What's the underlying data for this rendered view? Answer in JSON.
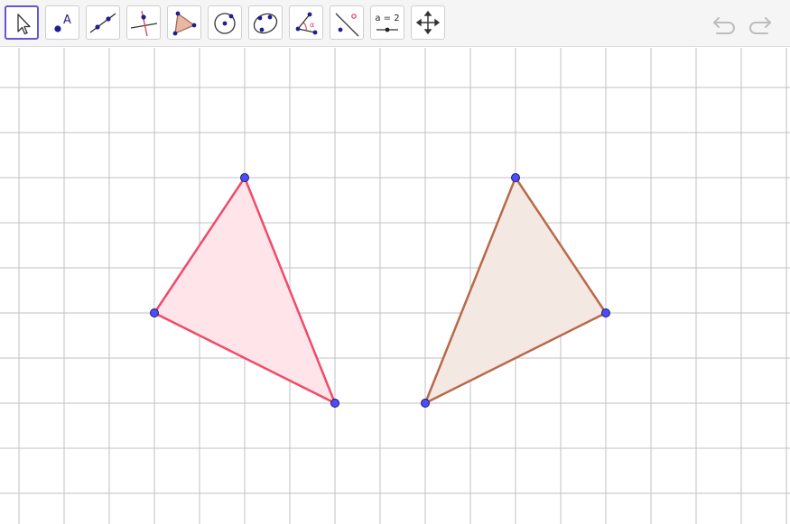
{
  "toolbar": {
    "tools": [
      {
        "name": "move-tool",
        "icon": "pointer-arrow-icon",
        "selected": true
      },
      {
        "name": "point-tool",
        "icon": "point-icon",
        "label": "A"
      },
      {
        "name": "line-tool",
        "icon": "line-through-two-points-icon"
      },
      {
        "name": "perpendicular-line-tool",
        "icon": "perpendicular-line-icon"
      },
      {
        "name": "polygon-tool",
        "icon": "polygon-icon"
      },
      {
        "name": "circle-tool",
        "icon": "circle-center-point-icon"
      },
      {
        "name": "conic-tool",
        "icon": "ellipse-icon"
      },
      {
        "name": "angle-tool",
        "icon": "angle-icon",
        "label": "α"
      },
      {
        "name": "reflect-tool",
        "icon": "reflect-about-line-icon"
      },
      {
        "name": "slider-tool",
        "icon": "slider-icon",
        "label": "a = 2"
      },
      {
        "name": "move-graphics-view-tool",
        "icon": "move-graphics-view-icon"
      }
    ],
    "undo_icon": "undo-icon",
    "redo_icon": "redo-icon"
  },
  "colors": {
    "accent": "#6557d2",
    "point_fill": "#4d4dff",
    "point_stroke": "#1a1a66",
    "triangle_left_stroke": "#ef4b6a",
    "triangle_left_fill": "#ffe4e9",
    "triangle_right_stroke": "#b86a4a",
    "triangle_right_fill": "#f3e8e2",
    "grid": "#c0c0c0"
  },
  "graphics": {
    "grid": true,
    "grid_step": 1,
    "triangles": [
      {
        "name": "triangle-left",
        "vertices": [
          [
            5,
            5
          ],
          [
            3,
            2
          ],
          [
            7,
            0
          ]
        ],
        "stroke": "triangle_left_stroke",
        "fill": "triangle_left_fill"
      },
      {
        "name": "triangle-right",
        "vertices": [
          [
            11,
            5
          ],
          [
            13,
            2
          ],
          [
            9,
            0
          ]
        ],
        "stroke": "triangle_right_stroke",
        "fill": "triangle_right_fill"
      }
    ]
  }
}
